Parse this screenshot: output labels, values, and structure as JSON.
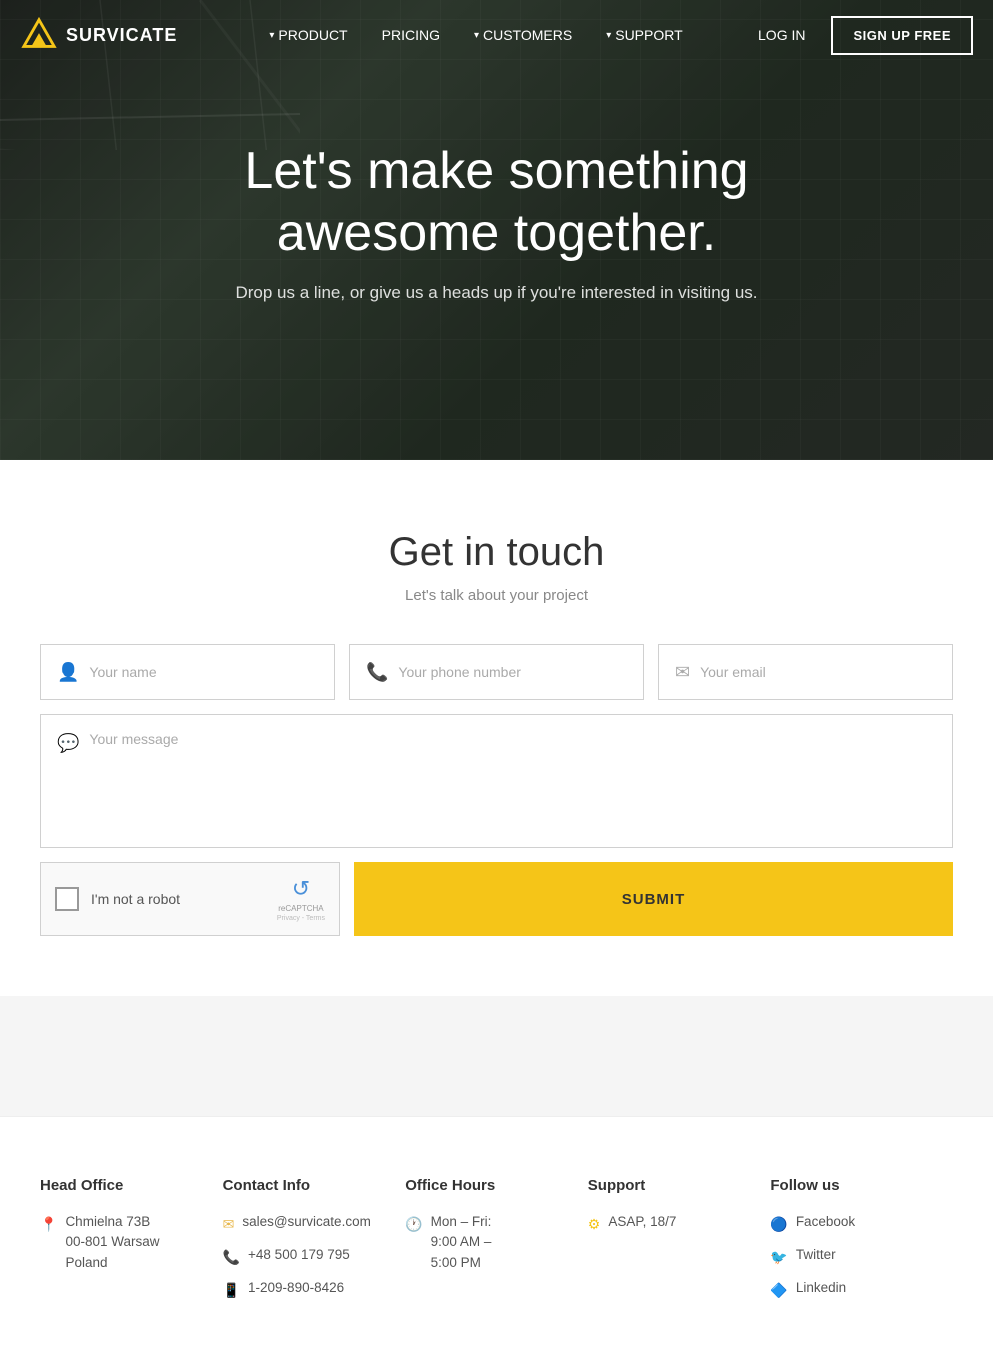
{
  "navbar": {
    "logo_text": "SURVICATE",
    "nav_items": [
      {
        "label": "PRODUCT",
        "has_caret": true
      },
      {
        "label": "PRICING",
        "has_caret": false
      },
      {
        "label": "CUSTOMERS",
        "has_caret": true
      },
      {
        "label": "SUPPORT",
        "has_caret": true
      }
    ],
    "login_label": "LOG IN",
    "signup_label": "SIGN UP FREE"
  },
  "hero": {
    "title": "Let's make something awesome together.",
    "subtitle": "Drop us a line, or give us a heads up if you're interested in visiting us."
  },
  "contact": {
    "heading": "Get in touch",
    "subheading": "Let's talk about your project",
    "name_placeholder": "Your name",
    "phone_placeholder": "Your phone number",
    "email_placeholder": "Your email",
    "message_placeholder": "Your message",
    "recaptcha_label": "I'm not a robot",
    "recaptcha_logo": "reCAPTCHA",
    "recaptcha_sub1": "Privacy",
    "recaptcha_sub2": "Terms",
    "submit_label": "SUBMIT"
  },
  "footer": {
    "col1": {
      "title": "Head Office",
      "address_line1": "Chmielna 73B",
      "address_line2": "00-801 Warsaw",
      "address_line3": "Poland"
    },
    "col2": {
      "title": "Contact Info",
      "email": "sales@survicate.com",
      "phone1": "+48 500 179 795",
      "phone2": "1-209-890-8426"
    },
    "col3": {
      "title": "Office Hours",
      "line1": "Mon – Fri:",
      "line2": "9:00 AM –",
      "line3": "5:00 PM"
    },
    "col4": {
      "title": "Support",
      "line1": "ASAP, 18/7"
    },
    "col5": {
      "title": "Follow us",
      "facebook": "Facebook",
      "twitter": "Twitter",
      "linkedin": "Linkedin"
    }
  }
}
